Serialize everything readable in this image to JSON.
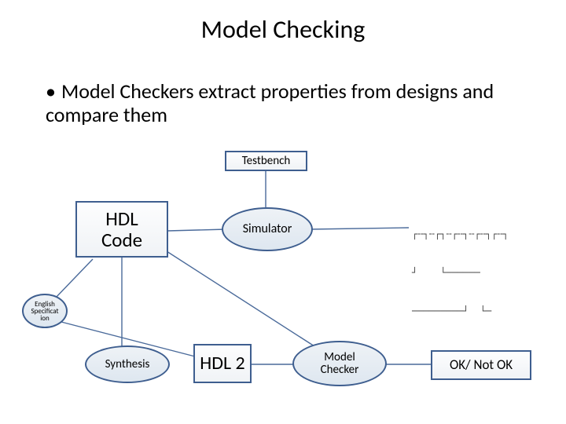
{
  "title": "Model Checking",
  "bullet": "Model Checkers extract properties from designs and compare them",
  "nodes": {
    "testbench": "Testbench",
    "hdl": "HDL\nCode",
    "simulator": "Simulator",
    "englishspec": "English\nSpecificat\nion",
    "synthesis": "Synthesis",
    "hdl2": "HDL 2",
    "modelchecker": "Model\nChecker",
    "okresult": "OK/ Not OK"
  },
  "waveform": {
    "line1": "┌╌┐╌┌┐╌┌╌┐╌┌╌┐┌╌┐",
    "line2": "┘    └──────",
    "line3": "─────────┘  └─"
  }
}
